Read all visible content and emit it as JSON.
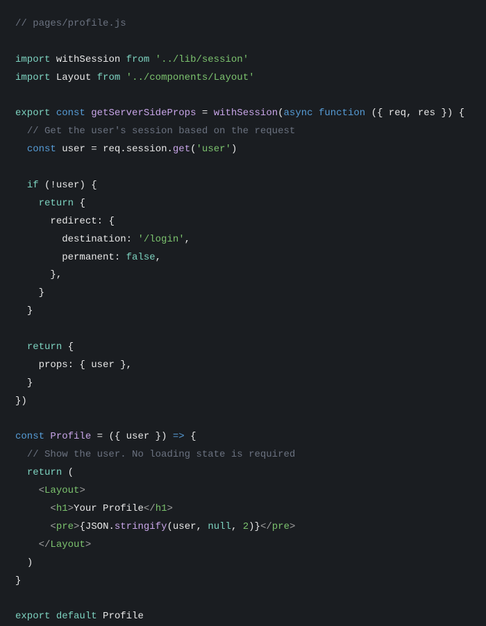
{
  "code": {
    "lines": [
      {
        "type": "comment",
        "content": "// pages/profile.js"
      },
      {
        "type": "blank"
      },
      {
        "type": "import",
        "keyword": "import",
        "name": "withSession",
        "from": "from",
        "path": "'../lib/session'"
      },
      {
        "type": "import",
        "keyword": "import",
        "name": "Layout",
        "from": "from",
        "path": "'../components/Layout'"
      },
      {
        "type": "blank"
      },
      {
        "type": "export-const",
        "content": "export const getServerSideProps = withSession(async function ({ req, res }) {"
      },
      {
        "type": "comment-indent",
        "indent": "  ",
        "content": "// Get the user's session based on the request"
      },
      {
        "type": "const-get",
        "indent": "  ",
        "content": "const user = req.session.get('user')"
      },
      {
        "type": "blank"
      },
      {
        "type": "if",
        "indent": "  ",
        "content": "if (!user) {"
      },
      {
        "type": "return",
        "indent": "    ",
        "content": "return {"
      },
      {
        "type": "prop",
        "indent": "      ",
        "content": "redirect: {"
      },
      {
        "type": "prop-string",
        "indent": "        ",
        "key": "destination:",
        "value": "'/login'",
        "trail": ","
      },
      {
        "type": "prop-bool",
        "indent": "        ",
        "key": "permanent:",
        "value": "false",
        "trail": ","
      },
      {
        "type": "close",
        "indent": "      ",
        "content": "},"
      },
      {
        "type": "close",
        "indent": "    ",
        "content": "}"
      },
      {
        "type": "close",
        "indent": "  ",
        "content": "}"
      },
      {
        "type": "blank"
      },
      {
        "type": "return",
        "indent": "  ",
        "content": "return {"
      },
      {
        "type": "props-user",
        "indent": "    ",
        "content": "props: { user },"
      },
      {
        "type": "close",
        "indent": "  ",
        "content": "}"
      },
      {
        "type": "close",
        "indent": "",
        "content": "})"
      },
      {
        "type": "blank"
      },
      {
        "type": "const-profile",
        "content": "const Profile = ({ user }) => {"
      },
      {
        "type": "comment-indent",
        "indent": "  ",
        "content": "// Show the user. No loading state is required"
      },
      {
        "type": "return-paren",
        "indent": "  ",
        "content": "return ("
      },
      {
        "type": "jsx-open",
        "indent": "    ",
        "tag": "Layout"
      },
      {
        "type": "jsx-h1",
        "indent": "      ",
        "open": "h1",
        "text": "Your Profile",
        "close": "h1"
      },
      {
        "type": "jsx-pre",
        "indent": "      ",
        "content": "<pre>{JSON.stringify(user, null, 2)}</pre>"
      },
      {
        "type": "jsx-close",
        "indent": "    ",
        "tag": "Layout"
      },
      {
        "type": "close",
        "indent": "  ",
        "content": ")"
      },
      {
        "type": "close",
        "indent": "",
        "content": "}"
      },
      {
        "type": "blank"
      },
      {
        "type": "export-default",
        "content": "export default Profile"
      }
    ]
  }
}
